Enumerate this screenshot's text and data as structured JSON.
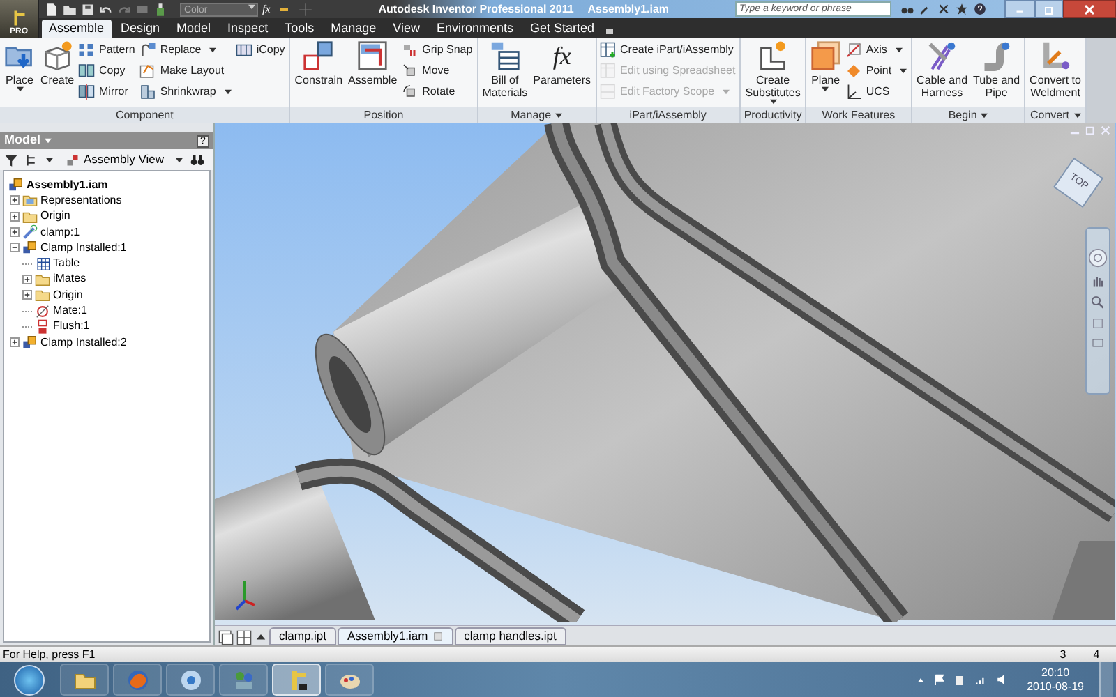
{
  "title_bar": {
    "quick_access_color": "Color",
    "formula_glyph": "fx",
    "title": "Autodesk Inventor Professional 2011",
    "document": "Assembly1.iam",
    "search_placeholder": "Type a keyword or phrase"
  },
  "app_button": {
    "label": "PRO"
  },
  "tabs": [
    {
      "label": "Assemble",
      "selected": true
    },
    {
      "label": "Design",
      "selected": false
    },
    {
      "label": "Model",
      "selected": false
    },
    {
      "label": "Inspect",
      "selected": false
    },
    {
      "label": "Tools",
      "selected": false
    },
    {
      "label": "Manage",
      "selected": false
    },
    {
      "label": "View",
      "selected": false
    },
    {
      "label": "Environments",
      "selected": false
    },
    {
      "label": "Get Started",
      "selected": false
    }
  ],
  "ribbon_panels": [
    {
      "label": "Component",
      "menu": false,
      "columns": [
        {
          "kind": "large",
          "label": "Place",
          "dropdown": true
        },
        {
          "kind": "large",
          "label": "Create",
          "dropdown": false
        },
        {
          "kind": "stack",
          "items": [
            {
              "label": "Pattern",
              "dropdown": false
            },
            {
              "label": "Copy",
              "dropdown": false
            },
            {
              "label": "Mirror",
              "dropdown": false
            }
          ]
        },
        {
          "kind": "stack",
          "items": [
            {
              "label": "Replace",
              "dropdown": true
            },
            {
              "label": "Make Layout",
              "dropdown": false
            },
            {
              "label": "Shrinkwrap",
              "dropdown": true
            }
          ]
        },
        {
          "kind": "stack",
          "items": [
            {
              "label": "iCopy",
              "dropdown": false
            }
          ]
        }
      ]
    },
    {
      "label": "Position",
      "menu": false,
      "columns": [
        {
          "kind": "large",
          "label": "Constrain",
          "dropdown": false
        },
        {
          "kind": "large",
          "label": "Assemble",
          "dropdown": false
        },
        {
          "kind": "stack",
          "items": [
            {
              "label": "Grip Snap",
              "dropdown": false
            },
            {
              "label": "Move",
              "dropdown": false
            },
            {
              "label": "Rotate",
              "dropdown": false
            }
          ]
        }
      ]
    },
    {
      "label": "Manage",
      "menu": true,
      "columns": [
        {
          "kind": "large",
          "label": "Bill of\nMaterials",
          "dropdown": false
        },
        {
          "kind": "glyph",
          "glyph": "fx",
          "label": "Parameters",
          "dropdown": false
        }
      ]
    },
    {
      "label": "iPart/iAssembly",
      "menu": false,
      "columns": [
        {
          "kind": "stack",
          "items": [
            {
              "label": "Create iPart/iAssembly",
              "dropdown": false,
              "disabled": false
            },
            {
              "label": "Edit using Spreadsheet",
              "dropdown": false,
              "disabled": true
            },
            {
              "label": "Edit Factory Scope",
              "dropdown": true,
              "disabled": true
            }
          ]
        }
      ]
    },
    {
      "label": "Productivity",
      "menu": false,
      "columns": [
        {
          "kind": "large",
          "label": "Create\nSubstitutes",
          "dropdown": true
        }
      ]
    },
    {
      "label": "Work Features",
      "menu": false,
      "columns": [
        {
          "kind": "large",
          "label": "Plane",
          "dropdown": true
        },
        {
          "kind": "stack",
          "items": [
            {
              "label": "Axis",
              "dropdown": true
            },
            {
              "label": "Point",
              "dropdown": true
            },
            {
              "label": "UCS",
              "dropdown": false
            }
          ]
        }
      ]
    },
    {
      "label": "Begin",
      "menu": true,
      "columns": [
        {
          "kind": "large",
          "label": "Cable and\nHarness",
          "dropdown": false
        },
        {
          "kind": "large",
          "label": "Tube and\nPipe",
          "dropdown": false
        }
      ]
    },
    {
      "label": "Convert",
      "menu": true,
      "columns": [
        {
          "kind": "large",
          "label": "Convert to\nWeldment",
          "dropdown": false
        }
      ]
    }
  ],
  "model_panel": {
    "title": "Model",
    "help_glyph": "?",
    "view": "Assembly View",
    "tree": [
      {
        "label": "Assembly1.iam",
        "kind": "assembly",
        "children": [
          {
            "label": "Representations",
            "kind": "representations",
            "expanded": false
          },
          {
            "label": "Origin",
            "kind": "folder",
            "expanded": false
          },
          {
            "label": "clamp:1",
            "kind": "part",
            "expanded": false
          },
          {
            "label": "Clamp Installed:1",
            "kind": "assembly",
            "expanded": true,
            "children": [
              {
                "label": "Table",
                "kind": "table"
              },
              {
                "label": "iMates",
                "kind": "folder",
                "expanded": false
              },
              {
                "label": "Origin",
                "kind": "folder",
                "expanded": false
              },
              {
                "label": "Mate:1",
                "kind": "mate"
              },
              {
                "label": "Flush:1",
                "kind": "flush"
              }
            ]
          },
          {
            "label": "Clamp Installed:2",
            "kind": "assembly",
            "expanded": false
          }
        ]
      }
    ]
  },
  "viewport": {
    "viewcube_label": "TOP"
  },
  "doc_tabs": [
    {
      "label": "clamp.ipt",
      "selected": false
    },
    {
      "label": "Assembly1.iam",
      "selected": true
    },
    {
      "label": "clamp handles.ipt",
      "selected": false
    }
  ],
  "status_bar": {
    "help": "For Help, press F1",
    "fields": [
      "3",
      "4"
    ]
  },
  "taskbar": {
    "apps": [
      {
        "selected": false
      },
      {
        "selected": false
      },
      {
        "selected": false
      },
      {
        "selected": false
      },
      {
        "selected": true
      },
      {
        "selected": false
      }
    ],
    "time": "20:10",
    "date": "2010-08-19"
  }
}
